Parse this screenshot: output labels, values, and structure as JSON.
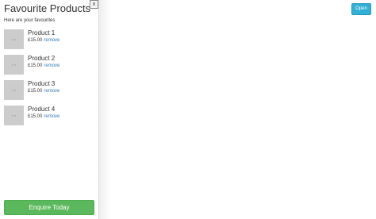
{
  "panel": {
    "title": "Favourite Products",
    "close_label": "x",
    "subtitle": "Here are your favourites",
    "products": [
      {
        "name": "Product 1",
        "price": "£15.00",
        "remove_label": "remove"
      },
      {
        "name": "Product 2",
        "price": "£15.00",
        "remove_label": "remove"
      },
      {
        "name": "Product 3",
        "price": "£15.00",
        "remove_label": "remove"
      },
      {
        "name": "Product 4",
        "price": "£15.00",
        "remove_label": "remove"
      }
    ],
    "thumbnail_icon": "image-placeholder-icon",
    "enquire_label": "Enquire Today"
  },
  "toolbar": {
    "open_label": "Open"
  },
  "colors": {
    "enquire_button": "#5cb85c",
    "open_button": "#31b0d5",
    "link": "#337ab7",
    "thumbnail": "#cccccc"
  }
}
